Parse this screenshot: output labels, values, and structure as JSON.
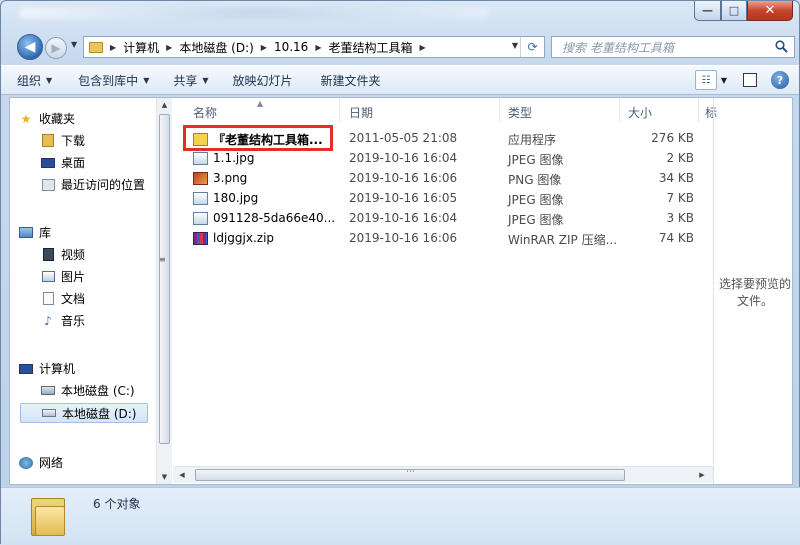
{
  "window": {
    "controls": {
      "minimize": "—",
      "maximize": "□",
      "close": "✕"
    }
  },
  "nav": {
    "back": "◀",
    "forward": "▶",
    "breadcrumb": [
      "计算机",
      "本地磁盘 (D:)",
      "10.16",
      "老董结构工具箱"
    ],
    "search_placeholder": "搜索 老董结构工具箱"
  },
  "toolbar": {
    "organize": "组织",
    "include_in_library": "包含到库中",
    "share": "共享",
    "slideshow": "放映幻灯片",
    "new_folder": "新建文件夹",
    "help": "?"
  },
  "sidebar": {
    "favorites": "收藏夹",
    "downloads": "下载",
    "desktop": "桌面",
    "recent": "最近访问的位置",
    "libraries": "库",
    "videos": "视频",
    "pictures": "图片",
    "documents": "文档",
    "music": "音乐",
    "computer": "计算机",
    "drive_c": "本地磁盘 (C:)",
    "drive_d": "本地磁盘 (D:)",
    "network": "网络"
  },
  "columns": {
    "name": "名称",
    "date": "日期",
    "type": "类型",
    "size": "大小",
    "extra": "标"
  },
  "files": [
    {
      "name": "『老董结构工具箱...",
      "date": "2011-05-05 21:08",
      "type": "应用程序",
      "size": "276 KB",
      "icon": "app-icon"
    },
    {
      "name": "1.1.jpg",
      "date": "2019-10-16 16:04",
      "type": "JPEG 图像",
      "size": "2 KB",
      "icon": "image-icon"
    },
    {
      "name": "3.png",
      "date": "2019-10-16 16:06",
      "type": "PNG 图像",
      "size": "34 KB",
      "icon": "png-icon"
    },
    {
      "name": "180.jpg",
      "date": "2019-10-16 16:05",
      "type": "JPEG 图像",
      "size": "7 KB",
      "icon": "image-icon"
    },
    {
      "name": "091128-5da66e40...",
      "date": "2019-10-16 16:04",
      "type": "JPEG 图像",
      "size": "3 KB",
      "icon": "image-icon"
    },
    {
      "name": "ldjggjx.zip",
      "date": "2019-10-16 16:06",
      "type": "WinRAR ZIP 压缩...",
      "size": "74 KB",
      "icon": "zip-icon"
    }
  ],
  "preview": {
    "line1": "选择要预览的",
    "line2": "文件。"
  },
  "details": {
    "count": "6 个对象"
  },
  "colors": {
    "highlight": "#e32c2c",
    "close_button": "#c7452c"
  }
}
